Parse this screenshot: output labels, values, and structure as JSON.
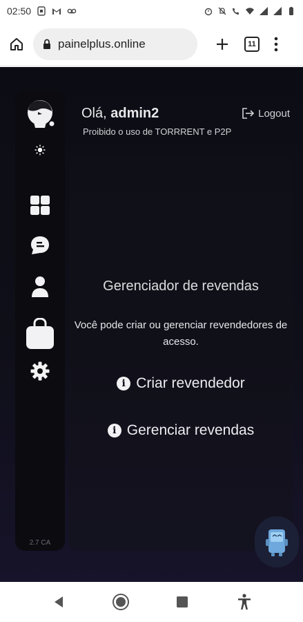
{
  "status_bar": {
    "time": "02:50",
    "left_icons": [
      "sim-card-icon",
      "gmail-icon",
      "voicemail-icon"
    ],
    "right_icons": [
      "alarm-icon",
      "silent-icon",
      "wifi-call-icon",
      "wifi-icon",
      "signal-icon",
      "signal-icon",
      "battery-icon"
    ]
  },
  "browser": {
    "url": "painelplus.online",
    "tab_count": "11"
  },
  "header": {
    "greeting": "Olá,",
    "username": "admin2",
    "notice": "Proibido o uso de TORRRENT e P2P",
    "logout_label": "Logout"
  },
  "sidebar": {
    "items": [
      {
        "icon": "dashboard-icon"
      },
      {
        "icon": "chat-icon"
      },
      {
        "icon": "user-icon"
      },
      {
        "icon": "bag-icon"
      },
      {
        "icon": "gear-icon"
      }
    ],
    "version": "2.7 CA"
  },
  "panel": {
    "title": "Gerenciador de revendas",
    "description": "Você pode criar ou gerenciar revendedores de acesso.",
    "actions": [
      {
        "label": "Criar revendedor"
      },
      {
        "label": "Gerenciar revendas"
      }
    ]
  },
  "colors": {
    "app_background": "#0f0f19",
    "sidebar_background": "#0b0b10",
    "text_primary": "#ececf0"
  }
}
